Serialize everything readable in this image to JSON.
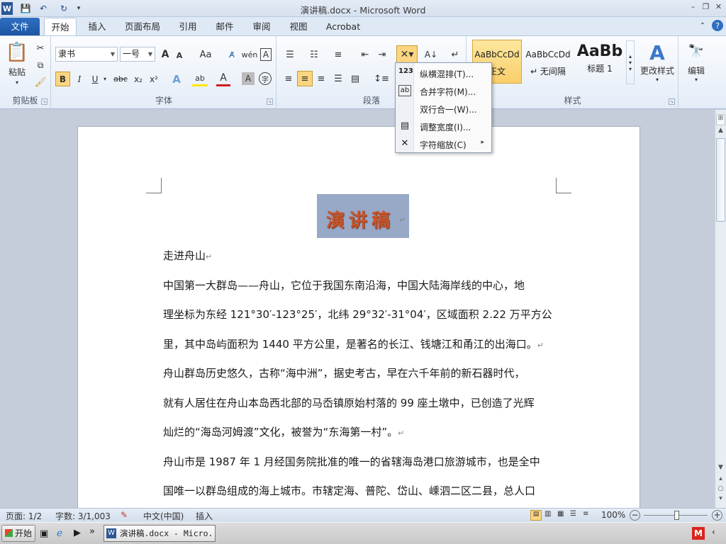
{
  "window": {
    "title": "演讲稿.docx - Microsoft Word",
    "quick_access": [
      "W",
      "💾",
      "↶",
      "↻"
    ]
  },
  "tabs": [
    {
      "label": "文件"
    },
    {
      "label": "开始"
    },
    {
      "label": "插入"
    },
    {
      "label": "页面布局"
    },
    {
      "label": "引用"
    },
    {
      "label": "邮件"
    },
    {
      "label": "审阅"
    },
    {
      "label": "视图"
    },
    {
      "label": "Acrobat"
    }
  ],
  "ribbon": {
    "clipboard": {
      "label": "剪贴板",
      "paste_label": "粘贴"
    },
    "font": {
      "label": "字体",
      "font_name": "隶书",
      "font_size": "一号",
      "grow": "A",
      "shrink": "A",
      "case": "Aa",
      "bold": "B",
      "italic": "I",
      "underline": "U",
      "strike": "abc",
      "sub": "x₂",
      "sup": "x²",
      "effects": "A",
      "highlight": "ab",
      "color": "A",
      "shade": "A",
      "circle": "字"
    },
    "paragraph": {
      "label": "段落"
    },
    "styles": {
      "label": "样式",
      "items": [
        {
          "preview": "AaBbCcDd",
          "name": "正文"
        },
        {
          "preview": "AaBbCcDd",
          "name": "↵ 无间隔"
        },
        {
          "preview": "AaBb",
          "name": "标题 1"
        }
      ],
      "change_label": "更改样式"
    },
    "editing": {
      "label": "编辑"
    }
  },
  "dropdown": {
    "items": [
      {
        "icon": "123",
        "label": "纵横混排(T)..."
      },
      {
        "icon": "ab",
        "label": "合并字符(M)..."
      },
      {
        "icon": "",
        "label": "双行合一(W)..."
      },
      {
        "icon": "",
        "label": "调整宽度(I)..."
      },
      {
        "icon": "",
        "label": "字符缩放(C)",
        "submenu": "▸"
      }
    ]
  },
  "document": {
    "title": "演讲稿",
    "lines": [
      "走进舟山",
      "中国第一大群岛——舟山，它位于我国东南沿海，中国大陆海岸线的中心，地",
      "理坐标为东经 121°30′-123°25′，北纬 29°32′-31°04′，区域面积 2.22 万平方公",
      "里，其中岛屿面积为 1440 平方公里，是著名的长江、钱塘江和甬江的出海口。",
      "舟山群岛历史悠久，古称“海中洲”，据史考古，早在六千年前的新石器时代，",
      "就有人居住在舟山本岛西北部的马岙镇原始村落的 99 座土墩中，已创造了光辉",
      "灿烂的“海岛河姆渡”文化，被誉为“东海第一村”。",
      "舟山市是 1987 年 1 月经国务院批准的唯一的省辖海岛港口旅游城市，也是全中",
      "国唯一以群岛组成的海上城市。市辖定海、普陀、岱山、嵊泗二区二县，总人口"
    ]
  },
  "status": {
    "page": "页面: 1/2",
    "words": "字数: 3/1,003",
    "language": "中文(中国)",
    "mode": "插入",
    "zoom": "100%",
    "zoom_minus": "−",
    "zoom_plus": "+"
  },
  "taskbar": {
    "start": "开始",
    "item": "演讲稿.docx - Micro..."
  }
}
